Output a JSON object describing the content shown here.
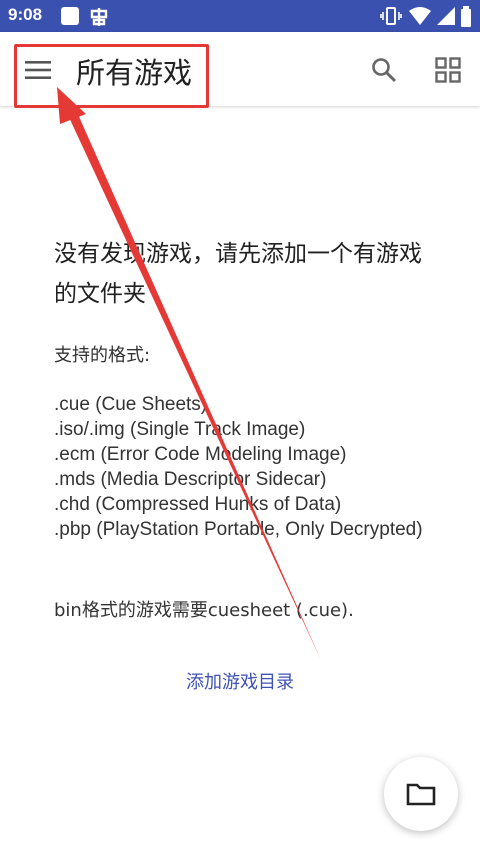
{
  "status_bar": {
    "time": "9:08"
  },
  "app_bar": {
    "title": "所有游戏",
    "icons": [
      "menu-icon",
      "search-icon",
      "grid-view-icon"
    ]
  },
  "empty_state": {
    "title": "没有发现游戏，请先添加一个有游戏的文件夹",
    "formats_label": "支持的格式:",
    "formats": [
      ".cue (Cue Sheets)",
      ".iso/.img (Single Track Image)",
      ".ecm (Error Code Modeling Image)",
      ".mds (Media Descriptor Sidecar)",
      ".chd (Compressed Hunks of Data)",
      ".pbp (PlayStation Portable, Only Decrypted)"
    ],
    "bin_note": "bin格式的游戏需要cuesheet (.cue).",
    "add_directory": "添加游戏目录"
  },
  "fab": {
    "icon": "folder-icon"
  },
  "colors": {
    "status_bar": "#3a51b0",
    "accent": "#3f51b5",
    "annotation": "#e53935"
  }
}
